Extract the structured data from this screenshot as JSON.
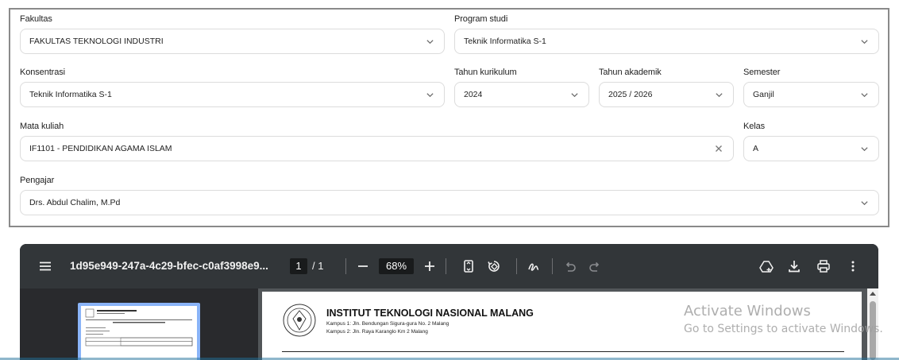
{
  "form": {
    "fakultas": {
      "label": "Fakultas",
      "value": "FAKULTAS TEKNOLOGI INDUSTRI"
    },
    "program_studi": {
      "label": "Program studi",
      "value": "Teknik Informatika S-1"
    },
    "konsentrasi": {
      "label": "Konsentrasi",
      "value": "Teknik Informatika S-1"
    },
    "tahun_kurikulum": {
      "label": "Tahun kurikulum",
      "value": "2024"
    },
    "tahun_akademik": {
      "label": "Tahun akademik",
      "value": "2025 / 2026"
    },
    "semester": {
      "label": "Semester",
      "value": "Ganjil"
    },
    "mata_kuliah": {
      "label": "Mata kuliah",
      "value": "IF1101 - PENDIDIKAN AGAMA ISLAM"
    },
    "kelas": {
      "label": "Kelas",
      "value": "A"
    },
    "pengajar": {
      "label": "Pengajar",
      "value": "Drs. Abdul Chalim, M.Pd"
    }
  },
  "pdf_viewer": {
    "file_name": "1d95e949-247a-4c29-bfec-c0af3998e9...",
    "current_page": "1",
    "page_separator": "/ 1",
    "zoom": "68%",
    "icons": [
      "menu-icon",
      "zoom-out-icon",
      "zoom-in-icon",
      "fit-page-icon",
      "rotate-icon",
      "annotate-icon",
      "undo-icon",
      "redo-icon",
      "save-drive-icon",
      "download-icon",
      "print-icon",
      "more-icon"
    ],
    "document": {
      "institution": "INSTITUT TEKNOLOGI NASIONAL MALANG",
      "address_1": "Kampus 1: Jln. Bendungan Sigura-gura No. 2 Malang",
      "address_2": "Kampus 2: Jln. Raya Karanglo Km 2 Malang"
    }
  },
  "watermark": {
    "line1": "Activate Windows",
    "line2": "Go to Settings to activate Windows."
  },
  "colors": {
    "viewer_toolbar": "#323639",
    "viewer_sidebar": "#292a2d",
    "thumbnail_border": "#8ab4f8",
    "panel_border": "#8a8a8a"
  }
}
